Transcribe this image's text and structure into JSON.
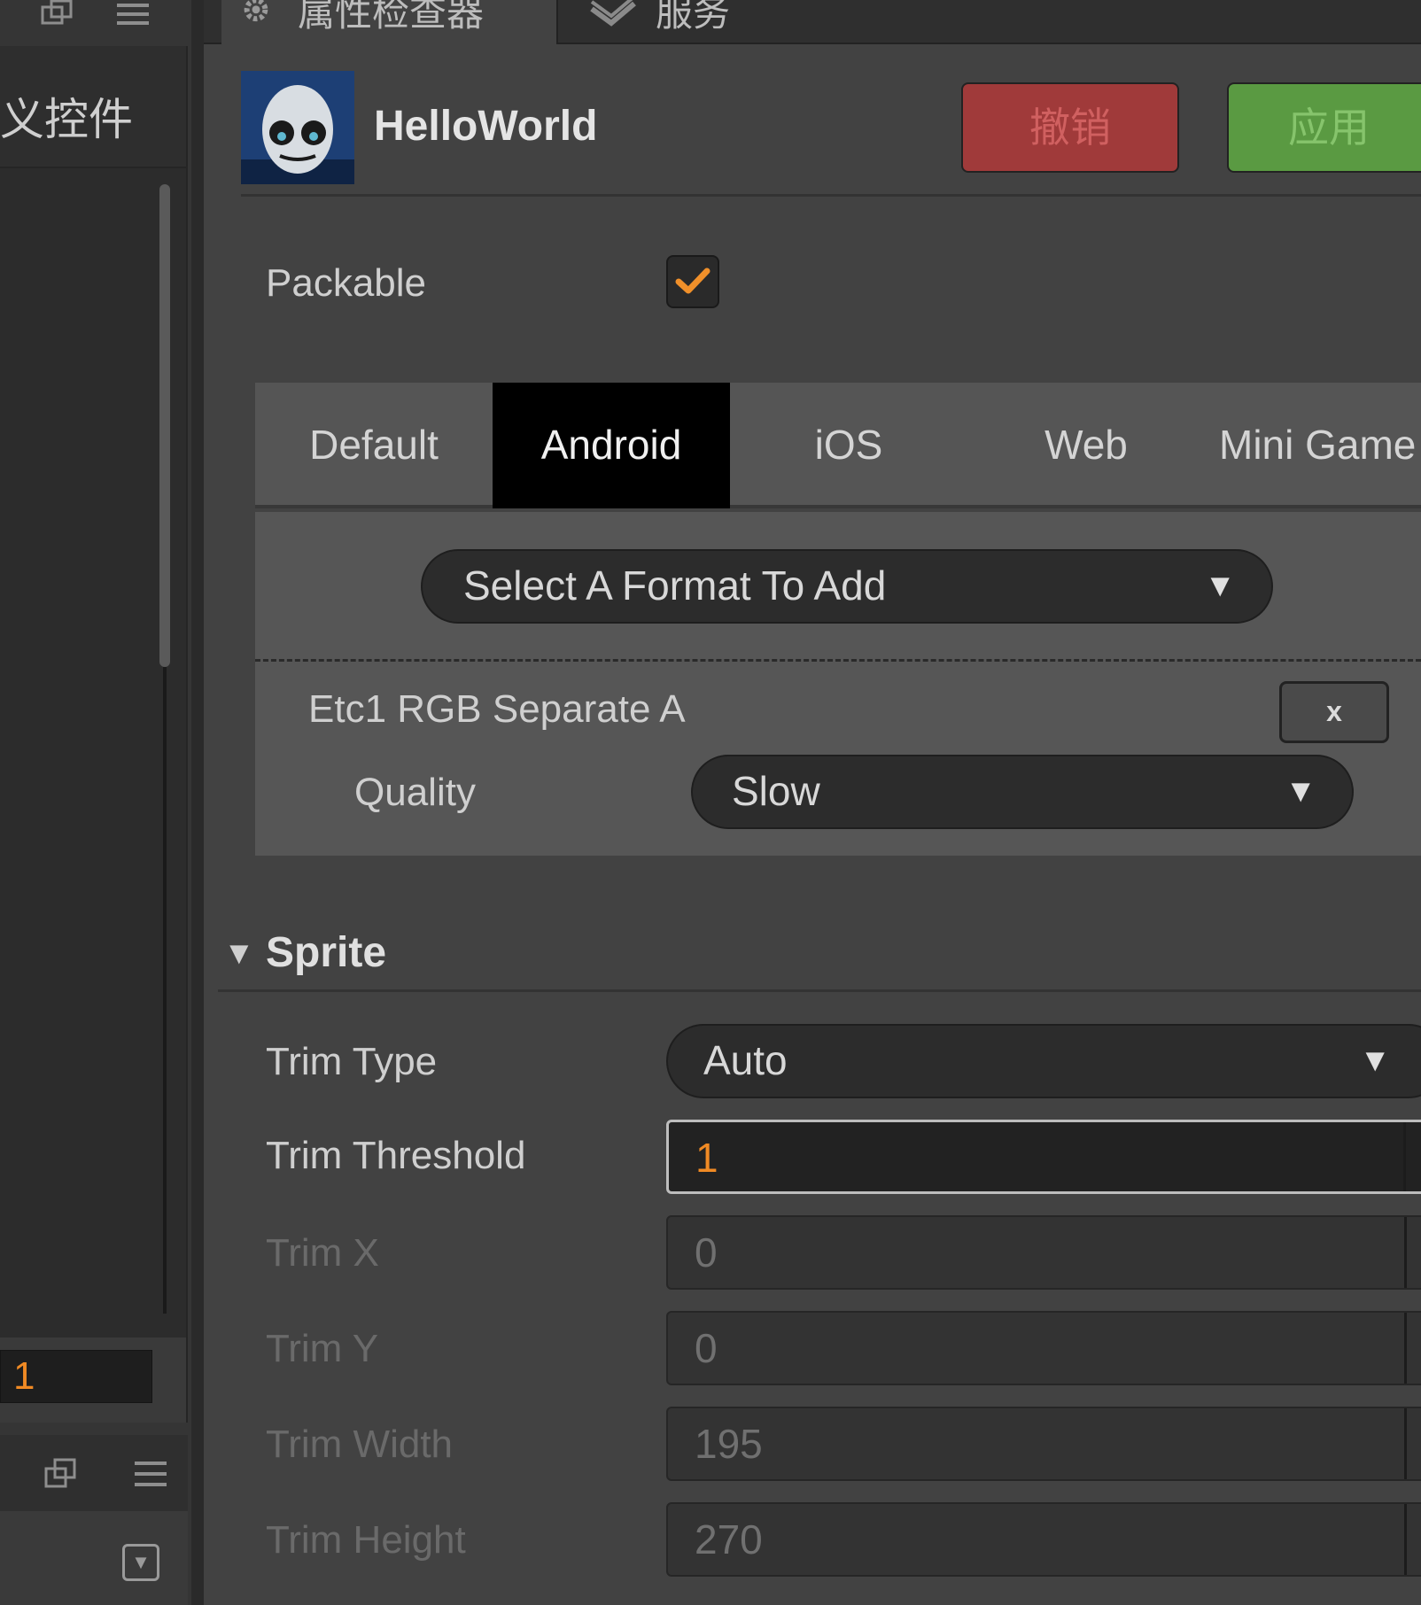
{
  "left_panel": {
    "title": "义控件",
    "number_value": "1",
    "icons": [
      "window-icon",
      "menu-icon",
      "collapse-icon"
    ]
  },
  "tabs": {
    "inspector": "属性检查器",
    "services": "服务"
  },
  "asset": {
    "name": "HelloWorld",
    "revert_label": "撤销",
    "apply_label": "应用"
  },
  "packable": {
    "label": "Packable",
    "checked": true
  },
  "platforms": {
    "tabs": [
      "Default",
      "Android",
      "iOS",
      "Web",
      "Mini Game"
    ],
    "active": "Android"
  },
  "format": {
    "select_placeholder": "Select A Format To Add",
    "name": "Etc1 RGB Separate A",
    "remove_label": "x",
    "quality_label": "Quality",
    "quality_value": "Slow"
  },
  "sprite": {
    "title": "Sprite",
    "trim_type_label": "Trim Type",
    "trim_type_value": "Auto",
    "trim_threshold_label": "Trim Threshold",
    "trim_threshold_value": "1",
    "trim_x_label": "Trim X",
    "trim_x_value": "0",
    "trim_y_label": "Trim Y",
    "trim_y_value": "0",
    "trim_width_label": "Trim Width",
    "trim_width_value": "195",
    "trim_height_label": "Trim Height",
    "trim_height_value": "270"
  },
  "colors": {
    "accent_orange": "#f08a24",
    "revert_red": "#a03a3a",
    "apply_green": "#5a9a42"
  }
}
